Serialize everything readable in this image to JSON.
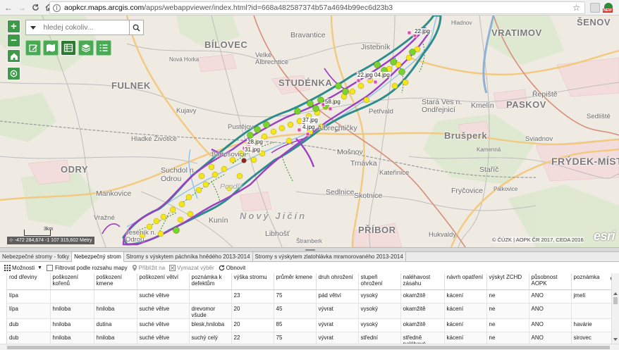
{
  "browser": {
    "url_domain": "aopkcr.maps.arcgis.com",
    "url_path": "/apps/webappviewer/index.html?id=668a482587374b57a4694b99ec6d23b3"
  },
  "search": {
    "placeholder": "hledej cokoliv..."
  },
  "map": {
    "places": [
      {
        "label": "VRATIMOV",
        "cls": "big"
      },
      {
        "label": "ŠENOV",
        "cls": "big"
      },
      {
        "label": "BÍLOVEC",
        "cls": "big"
      },
      {
        "label": "Bravantice",
        "cls": "md"
      },
      {
        "label": "Jistebník",
        "cls": "md"
      },
      {
        "label": "Velké Albrechtice",
        "cls": "sm"
      },
      {
        "label": "Nová Horka",
        "cls": "xs"
      },
      {
        "label": "Hladnov",
        "cls": "xs"
      },
      {
        "label": "FULNEK",
        "cls": "big"
      },
      {
        "label": "STUDÉNKA",
        "cls": "big"
      },
      {
        "label": "Stará Ves n. Ondřejnicí",
        "cls": "md"
      },
      {
        "label": "Kujavy",
        "cls": "sm"
      },
      {
        "label": "Pustějov",
        "cls": "sm"
      },
      {
        "label": "Albrechtičky",
        "cls": "md"
      },
      {
        "label": "Petřvald",
        "cls": "sm"
      },
      {
        "label": "Kmelín",
        "cls": "md"
      },
      {
        "label": "Řepiště",
        "cls": "md"
      },
      {
        "label": "Sedliště",
        "cls": "sm"
      },
      {
        "label": "PASKOV",
        "cls": "big"
      },
      {
        "label": "Brušperk",
        "cls": "big"
      },
      {
        "label": "Hladké Životice",
        "cls": "sm"
      },
      {
        "label": "Bartošovice",
        "cls": "sm"
      },
      {
        "label": "Mošnov",
        "cls": "md"
      },
      {
        "label": "Trnávka",
        "cls": "md"
      },
      {
        "label": "Kateřinice",
        "cls": "sm"
      },
      {
        "label": "Staříč",
        "cls": "md"
      },
      {
        "label": "Sviadnov",
        "cls": "sm"
      },
      {
        "label": "FRÝDEK-MÍSTEK",
        "cls": "big"
      },
      {
        "label": "ODRY",
        "cls": "big"
      },
      {
        "label": "Suchdol n. Odrou",
        "cls": "md"
      },
      {
        "label": "Mankovice",
        "cls": "md"
      },
      {
        "label": "Sedlnice",
        "cls": "md"
      },
      {
        "label": "Skotnice",
        "cls": "md"
      },
      {
        "label": "Fryčovice",
        "cls": "md"
      },
      {
        "label": "Poodří",
        "cls": "md ital"
      },
      {
        "label": "Nový Jičín",
        "cls": "big ital"
      },
      {
        "label": "Kunín",
        "cls": "md"
      },
      {
        "label": "Vražné",
        "cls": "sm"
      },
      {
        "label": "Jeseník n. Odrou",
        "cls": "sm"
      },
      {
        "label": "Libhošť",
        "cls": "md"
      },
      {
        "label": "PŘÍBOR",
        "cls": "big"
      },
      {
        "label": "Hukvaldy",
        "cls": "sm"
      },
      {
        "label": "Palkovice",
        "cls": "xs"
      },
      {
        "label": "Kamenná",
        "cls": "xs"
      },
      {
        "label": "Štramberk",
        "cls": "xs"
      }
    ],
    "photo_labels": [
      "22.jpg",
      "22.jpg 04.jpg",
      "58.jpg",
      "37.jpg",
      "4.jpg",
      "28.jpg",
      "31.jpg"
    ],
    "coords": "-472 284,674 -1 107 315,602 Metry",
    "scale_label": "3km",
    "attribution": "© ČÚZK | AOPK ČR 2017, CEDA 2016",
    "esri": "esri"
  },
  "table": {
    "tabs": [
      {
        "label": "Nebezpečné stromy - fotky",
        "active": false
      },
      {
        "label": "Nebezpečný strom",
        "active": true
      },
      {
        "label": "Stromy s výskytem páchníka hnědého 2013-2014",
        "active": false
      },
      {
        "label": "Stromy s výskytem zlatohlávka mramorovaného 2013-2014",
        "active": false
      }
    ],
    "toolbar": {
      "options": "Možnosti",
      "filter": "Filtrovat podle rozsahu mapy",
      "zoom": "Přiblížit na",
      "clear": "Vymazat výběr",
      "refresh": "Obnovit"
    },
    "columns": [
      "rod dřeviny",
      "poškození kořenů",
      "poškození kmene",
      "poškození větví",
      "poznámka k defektům",
      "výška stromu",
      "průměr kmene",
      "druh ohrožení",
      "stupeň ohrožení",
      "naléhavost zásahu",
      "návrh opatření",
      "výskyt ZCHD",
      "působnost AOPK",
      "poznámka"
    ],
    "rows": [
      [
        "lípa",
        "",
        "",
        "suché větve",
        "",
        "23",
        "75",
        "pád větví",
        "vysoký",
        "okamžitě",
        "kácení",
        "ne",
        "ANO",
        "jmelí"
      ],
      [
        "lípa",
        "hniloba",
        "hniloba",
        "suché větve",
        "drevomor všude",
        "20",
        "45",
        "vývrat",
        "vysoký",
        "okamžitě",
        "kácení",
        "ne",
        "ANO",
        ""
      ],
      [
        "dub",
        "hniloba",
        "dutina",
        "suché větve",
        "blesk,hniloba",
        "20",
        "85",
        "vývrat",
        "vysoký",
        "okamžitě",
        "kácení",
        "ne",
        "ANO",
        "havárie"
      ],
      [
        "dub",
        "hniloba",
        "hniloba",
        "suché větve",
        "suchý celý",
        "22",
        "75",
        "vývrat",
        "střední",
        "středně naléhavé",
        "kácení",
        "ne",
        "ANO",
        "sirovec"
      ]
    ]
  }
}
